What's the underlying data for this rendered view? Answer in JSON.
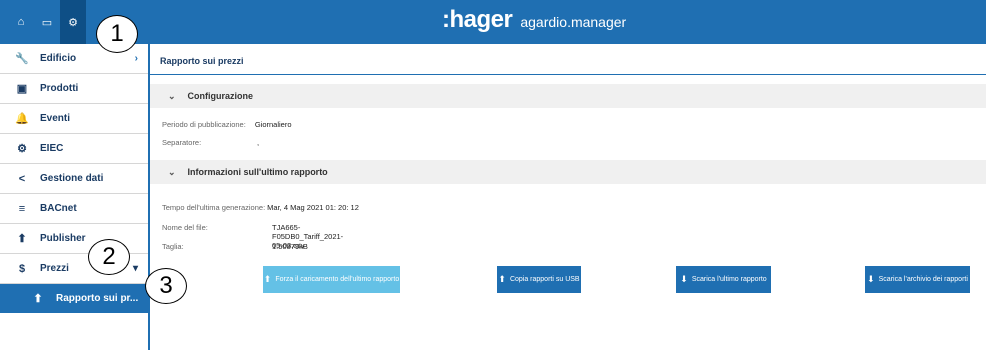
{
  "topbar": {
    "tabs": [
      {
        "icon": "home-icon",
        "glyph": "⌂"
      },
      {
        "icon": "monitor-icon",
        "glyph": "▭"
      },
      {
        "icon": "settings-icon",
        "glyph": "⚙"
      }
    ],
    "brand": ":hager",
    "product": "agardio.manager"
  },
  "callouts": [
    "1",
    "2",
    "3"
  ],
  "sidebar": {
    "items": [
      {
        "label": "Edificio",
        "icon": "wrench-icon",
        "glyph": "🔧",
        "chevron": "›"
      },
      {
        "label": "Prodotti",
        "icon": "box-icon",
        "glyph": "▣"
      },
      {
        "label": "Eventi",
        "icon": "bell-icon",
        "glyph": "🔔"
      },
      {
        "label": "EIEC",
        "icon": "gears-icon",
        "glyph": "⚙"
      },
      {
        "label": "Gestione dati",
        "icon": "share-icon",
        "glyph": "<"
      },
      {
        "label": "BACnet",
        "icon": "list-icon",
        "glyph": "≡"
      },
      {
        "label": "Publisher",
        "icon": "upload-icon",
        "glyph": "⬆"
      },
      {
        "label": "Prezzi",
        "icon": "dollar-icon",
        "glyph": "$",
        "chevron": "▾"
      }
    ],
    "sub_item": {
      "label": "Rapporto sui pr...",
      "icon": "upload-icon",
      "glyph": "⬆"
    }
  },
  "main": {
    "title": "Rapporto sui prezzi",
    "config": {
      "header": "Configurazione",
      "rows": [
        {
          "label": "Periodo di pubblicazione:",
          "value": "Giornaliero"
        },
        {
          "label": "Separatore:",
          "value": ","
        }
      ]
    },
    "last_report": {
      "header": "Informazioni sull'ultimo rapporto",
      "rows": [
        {
          "label": "Tempo dell'ultima generazione:",
          "value": "Mar, 4 Mag 2021 01: 20: 12"
        },
        {
          "label": "Nome del file:",
          "value": "TJA665-F05DB0_Tariff_2021-05-03.csv"
        },
        {
          "label": "Taglia:",
          "value": "1.50879kB"
        }
      ]
    },
    "buttons": [
      {
        "label": "Forza il caricamento dell'ultimo rapporto"
      },
      {
        "label": "Copia rapporti su USB"
      },
      {
        "label": "Scarica l'ultimo rapporto"
      },
      {
        "label": "Scarica l'archivio dei rapporti"
      }
    ],
    "colors": {
      "primary": "#1f6fb2",
      "light_button": "#64c1e6"
    }
  }
}
